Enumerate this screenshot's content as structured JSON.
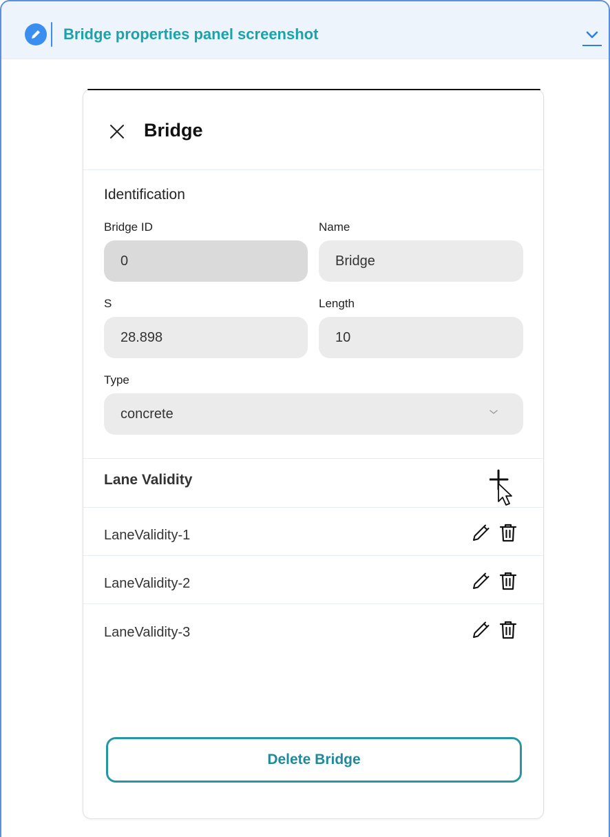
{
  "header": {
    "title": "Bridge properties panel screenshot",
    "accent_color": "#1aa3a9",
    "badge_icon": "pencil-icon",
    "collapse_icon": "chevron-down-icon"
  },
  "panel": {
    "title": "Bridge",
    "close_icon": "close-icon",
    "identification": {
      "section_title": "Identification",
      "bridge_id": {
        "label": "Bridge ID",
        "value": "0"
      },
      "name": {
        "label": "Name",
        "value": "Bridge"
      },
      "s": {
        "label": "S",
        "value": "28.898"
      },
      "length": {
        "label": "Length",
        "value": "10"
      },
      "type": {
        "label": "Type",
        "value": "concrete"
      }
    },
    "lane_validity": {
      "section_title": "Lane Validity",
      "add_icon": "plus-icon",
      "items": [
        {
          "label": "LaneValidity-1"
        },
        {
          "label": "LaneValidity-2"
        },
        {
          "label": "LaneValidity-3"
        }
      ]
    },
    "delete_label": "Delete Bridge",
    "delete_color": "#2796a3"
  }
}
